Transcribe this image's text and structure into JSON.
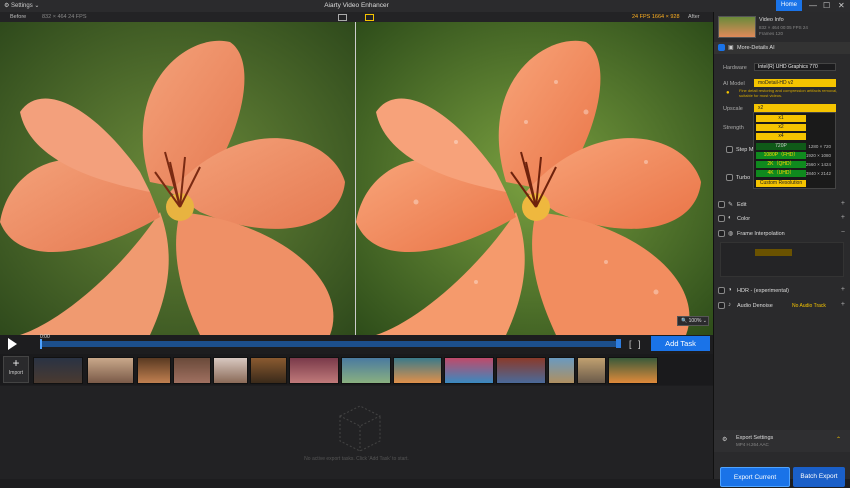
{
  "titlebar": {
    "settings": "Settings",
    "title": "Aiarty Video Enhancer",
    "home": "Home",
    "minimize": "—",
    "maximize": "☐",
    "close": "✕"
  },
  "subbar": {
    "before": "Before",
    "before_info": "832 × 464  24 FPS",
    "after_info": "24 FPS  1664 × 928",
    "after": "After"
  },
  "zoom": "100%",
  "timeline": {
    "time": "0:00",
    "add_task": "Add Task"
  },
  "strip": {
    "import": "Import"
  },
  "drop": {
    "message": "No active export tasks. Click 'Add Task' to start."
  },
  "panel": {
    "video_info": "Video Info",
    "video_meta_1": "832 × 464  00:05  FPS 24",
    "video_meta_2": "Frames 120",
    "more_details": "More-Details AI",
    "hardware_label": "Hardware",
    "hardware_value": "Intel(R) UHD Graphics 770",
    "aimodel_label": "AI Model",
    "aimodel_value": "moDetail-HD v2",
    "hint": "Fine detail restoring and compression artifacts removal, suitable for most videos.",
    "upscale_label": "Upscale",
    "upscale_value": "x2",
    "strength_label": "Strength",
    "step_mode": "Step Mode",
    "turbo": "Turbo",
    "upscale_options": [
      {
        "label": "x1",
        "res": ""
      },
      {
        "label": "x2",
        "res": ""
      },
      {
        "label": "x4",
        "res": ""
      },
      {
        "label": "720P",
        "res": "1280 × 720"
      },
      {
        "label": "1080P（FHD）",
        "res": "1920 × 1080"
      },
      {
        "label": "2K（QHD）",
        "res": "2560 × 1424"
      },
      {
        "label": "4K（UHD）",
        "res": "3840 × 2142"
      },
      {
        "label": "Custom Resolution",
        "res": ""
      }
    ],
    "edit": "Edit",
    "color": "Color",
    "frame_interp": "Frame Interpolation",
    "hdr": "HDR - (experimental)",
    "audio_denoise": "Audio Denoise",
    "no_audio": "No Audio Track",
    "export_settings": "Export Settings",
    "export_meta": "MP4  H.264  AAC",
    "export_current": "Export Current",
    "batch_export": "Batch Export"
  },
  "colors": {
    "accent": "#1a73e8",
    "highlight": "#f5c400",
    "green_option": "#0f8a1e"
  }
}
